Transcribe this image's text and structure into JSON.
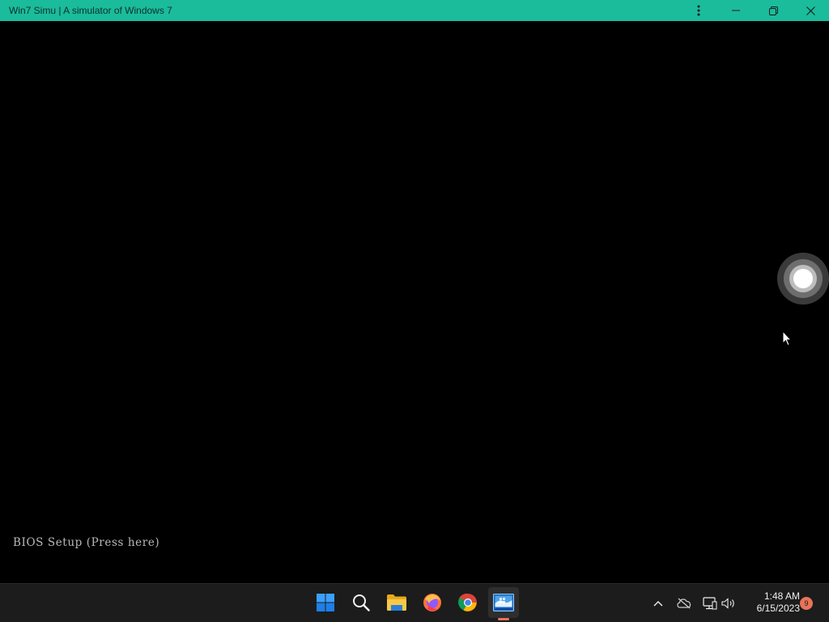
{
  "window": {
    "title": "Win7 Simu | A simulator of Windows 7",
    "controls": [
      "kebab-menu-icon",
      "minimize-icon",
      "restore-icon",
      "close-icon"
    ],
    "titlebar_color": "#1abc9c"
  },
  "screen": {
    "background": "#000000",
    "bios_link": "BIOS Setup (Press here)",
    "overlay": "assistive-touch-button"
  },
  "taskbar": {
    "apps": [
      {
        "name": "start",
        "icon": "windows-logo-icon"
      },
      {
        "name": "search",
        "icon": "search-icon"
      },
      {
        "name": "file-explorer",
        "icon": "folder-icon"
      },
      {
        "name": "firefox",
        "icon": "firefox-icon"
      },
      {
        "name": "chrome",
        "icon": "chrome-icon"
      },
      {
        "name": "win7-simu",
        "icon": "win7-simu-icon",
        "active": true
      }
    ],
    "tray": {
      "icons": [
        "chevron-up-icon",
        "cloud-offline-icon",
        "network-icon",
        "volume-icon"
      ],
      "time": "1:48 AM",
      "date": "6/15/2023",
      "notification_count": "9"
    },
    "accent": "#e8735a"
  }
}
